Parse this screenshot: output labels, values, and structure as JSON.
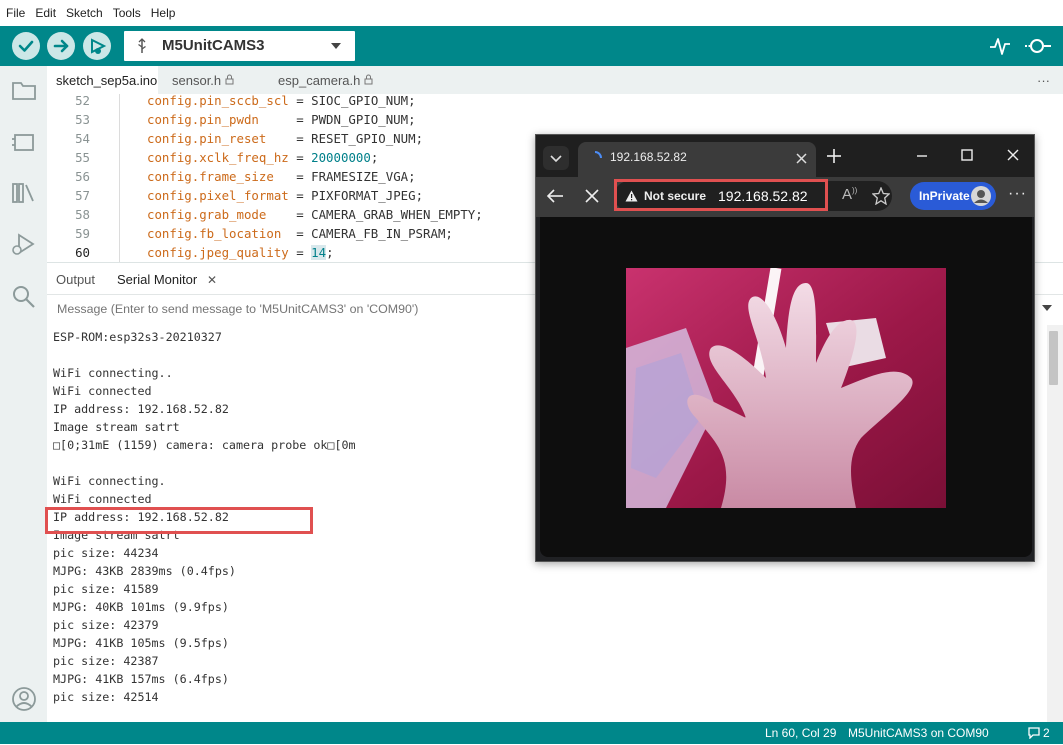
{
  "menu": [
    "File",
    "Edit",
    "Sketch",
    "Tools",
    "Help"
  ],
  "toolbar": {
    "board": "M5UnitCAMS3",
    "verify_icon": "check-icon",
    "upload_icon": "arrow-right-icon",
    "debug_icon": "debug-icon",
    "plotter_icon": "pulse-icon",
    "monitor_icon": "serial-monitor-icon"
  },
  "tabs": [
    {
      "label": "sketch_sep5a.ino",
      "active": true
    },
    {
      "label": "sensor.h",
      "locked": true
    },
    {
      "label": "esp_camera.h",
      "locked": true
    }
  ],
  "tabs_more": "···",
  "editor": {
    "lines": [
      {
        "n": "52",
        "field": "config.pin_sccb_scl",
        "pad": " = ",
        "val": "SIOC_GPIO_NUM",
        "end": ";"
      },
      {
        "n": "53",
        "field": "config.pin_pwdn",
        "pad": "     = ",
        "val": "PWDN_GPIO_NUM",
        "end": ";"
      },
      {
        "n": "54",
        "field": "config.pin_reset",
        "pad": "    = ",
        "val": "RESET_GPIO_NUM",
        "end": ";"
      },
      {
        "n": "55",
        "field": "config.xclk_freq_hz",
        "pad": " = ",
        "val": "20000000",
        "end": ";"
      },
      {
        "n": "56",
        "field": "config.frame_size",
        "pad": "   = ",
        "val": "FRAMESIZE_VGA",
        "end": ";"
      },
      {
        "n": "57",
        "field": "config.pixel_format",
        "pad": " = ",
        "val": "PIXFORMAT_JPEG",
        "end": ";"
      },
      {
        "n": "58",
        "field": "config.grab_mode",
        "pad": "    = ",
        "val": "CAMERA_GRAB_WHEN_EMPTY",
        "end": ";"
      },
      {
        "n": "59",
        "field": "config.fb_location",
        "pad": "  = ",
        "val": "CAMERA_FB_IN_PSRAM",
        "end": ";"
      },
      {
        "n": "60",
        "field": "config.jpeg_quality",
        "pad": " = ",
        "val": "14",
        "end": ";"
      }
    ]
  },
  "panel": {
    "tab_output": "Output",
    "tab_serial": "Serial Monitor",
    "close_glyph": "✕",
    "message_placeholder": "Message (Enter to send message to 'M5UnitCAMS3' on 'COM90')"
  },
  "serial_lines": [
    "ESP-ROM:esp32s3-20210327",
    "",
    "WiFi connecting..",
    "WiFi connected",
    "IP address: 192.168.52.82",
    "Image stream satrt",
    "□[0;31mE (1159) camera: camera probe ok□[0m",
    "",
    "WiFi connecting.",
    "WiFi connected",
    "IP address: 192.168.52.82",
    "Image stream satrt",
    "pic size: 44234",
    "MJPG: 43KB 2839ms (0.4fps)",
    "pic size: 41589",
    "MJPG: 40KB 101ms (9.9fps)",
    "pic size: 42379",
    "MJPG: 41KB 105ms (9.5fps)",
    "pic size: 42387",
    "MJPG: 41KB 157ms (6.4fps)",
    "pic size: 42514"
  ],
  "statusbar": {
    "position": "Ln 60, Col 29",
    "board_port": "M5UnitCAMS3 on COM90",
    "notifications": "2"
  },
  "browser": {
    "tab_title": "192.168.52.82",
    "not_secure": "Not secure",
    "url": "192.168.52.82",
    "inprivate": "InPrivate"
  },
  "colors": {
    "accent": "#00878a",
    "highlight_box": "#e05050",
    "inprivate": "#2a5bd7"
  }
}
